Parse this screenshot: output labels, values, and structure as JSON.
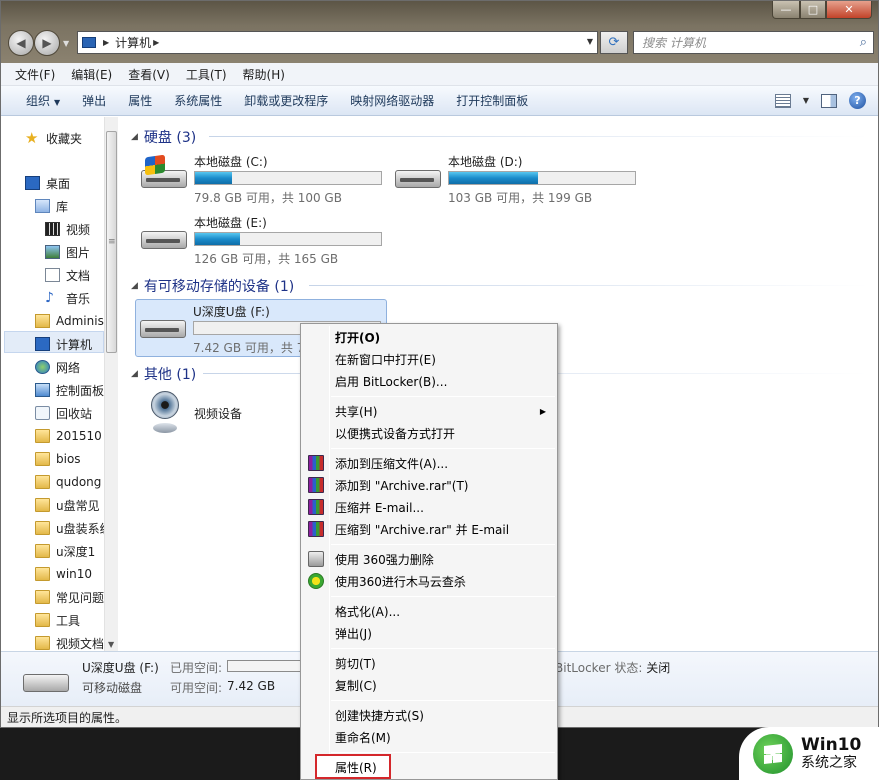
{
  "window": {
    "address": {
      "path_segment": "计算机"
    },
    "search": {
      "placeholder": "搜索 计算机"
    },
    "caption": {
      "minimize": "—",
      "maximize": "□",
      "close": "✕"
    }
  },
  "menubar": {
    "items": [
      "文件(F)",
      "编辑(E)",
      "查看(V)",
      "工具(T)",
      "帮助(H)"
    ]
  },
  "cmdbar": {
    "organize": "组织",
    "items": [
      "弹出",
      "属性",
      "系统属性",
      "卸载或更改程序",
      "映射网络驱动器",
      "打开控制面板"
    ],
    "help": "?"
  },
  "navpane": {
    "favorites": "收藏夹",
    "desktop": "桌面",
    "library": "库",
    "library_items": [
      "视频",
      "图片",
      "文档",
      "音乐"
    ],
    "user": "Adminis",
    "computer": "计算机",
    "network": "网络",
    "control_panel": "控制面板",
    "recycle_bin": "回收站",
    "folders": [
      "201510",
      "bios",
      "qudong",
      "u盘常见",
      "u盘装系统",
      "u深度1",
      "win10",
      "常见问题",
      "工具",
      "视频文档"
    ]
  },
  "content": {
    "groups": {
      "hdd": "硬盘 (3)",
      "removable": "有可移动存储的设备 (1)",
      "other": "其他 (1)"
    },
    "drives": [
      {
        "name": "本地磁盘 (C:)",
        "info": "79.8 GB 可用，共 100 GB",
        "used_fraction": 0.2
      },
      {
        "name": "本地磁盘 (D:)",
        "info": "103 GB 可用，共 199 GB",
        "used_fraction": 0.48
      },
      {
        "name": "本地磁盘 (E:)",
        "info": "126 GB 可用，共 165 GB",
        "used_fraction": 0.24
      },
      {
        "name": "U深度U盘 (F:)",
        "info": "7.42 GB 可用，共 7",
        "used_fraction": 0.0
      }
    ],
    "other_device": "视频设备"
  },
  "details": {
    "name": "U深度U盘 (F:)",
    "type": "可移动磁盘",
    "used_label": "已用空间:",
    "free_label": "可用空间:",
    "free_value": "7.42 GB",
    "bitlocker_label": "BitLocker 状态:",
    "bitlocker_value": "关闭"
  },
  "statusbar": {
    "text": "显示所选项目的属性。"
  },
  "context_menu": {
    "open": "打开(O)",
    "open_new_window": "在新窗口中打开(E)",
    "bitlocker": "启用 BitLocker(B)...",
    "share": "共享(H)",
    "portable": "以便携式设备方式打开",
    "add_archive": "添加到压缩文件(A)...",
    "add_archive_rar": "添加到 \"Archive.rar\"(T)",
    "compress_email": "压缩并 E-mail...",
    "compress_rar_email": "压缩到 \"Archive.rar\" 并 E-mail",
    "delete_360": "使用 360强力删除",
    "scan_360": "使用360进行木马云查杀",
    "format": "格式化(A)...",
    "eject": "弹出(J)",
    "cut": "剪切(T)",
    "copy": "复制(C)",
    "shortcut": "创建快捷方式(S)",
    "rename": "重命名(M)",
    "properties": "属性(R)"
  },
  "watermark": {
    "line1": "Win10",
    "line2": "系统之家"
  }
}
